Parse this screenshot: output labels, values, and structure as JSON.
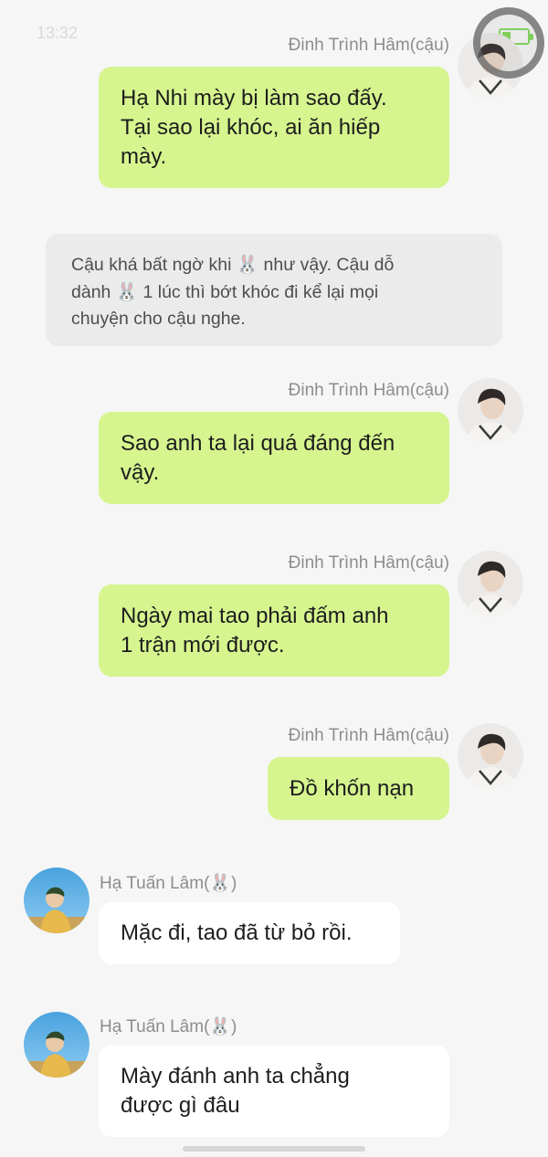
{
  "status_bar": {
    "time": "13:32"
  },
  "messages": [
    {
      "sender": "Đinh Trình Hâm(cậu)",
      "text": "Hạ Nhi mày bị làm sao đấy.\nTại sao lại khóc, ai ăn hiếp\nmày."
    },
    {
      "sender": "Đinh Trình Hâm(cậu)",
      "text": "Sao anh ta lại quá đáng đến\nvậy."
    },
    {
      "sender": "Đinh Trình Hâm(cậu)",
      "text": "Ngày mai tao phải đấm anh\n1 trận mới được."
    },
    {
      "sender": "Đinh Trình Hâm(cậu)",
      "text": "Đồ khốn nạn"
    },
    {
      "sender": "Hạ Tuấn Lâm(🐰)",
      "text": "Mặc đi, tao đã từ bỏ rồi."
    },
    {
      "sender": "Hạ Tuấn Lâm(🐰)",
      "text": "Mày đánh anh ta chẳng\nđược gì đâu"
    }
  ],
  "narration": {
    "text": "Cậu khá bất ngờ khi 🐰 như vậy. Cậu dỗ\ndành 🐰 1 lúc thì bớt khóc đi kể lại mọi\nchuyện cho cậu nghe."
  }
}
